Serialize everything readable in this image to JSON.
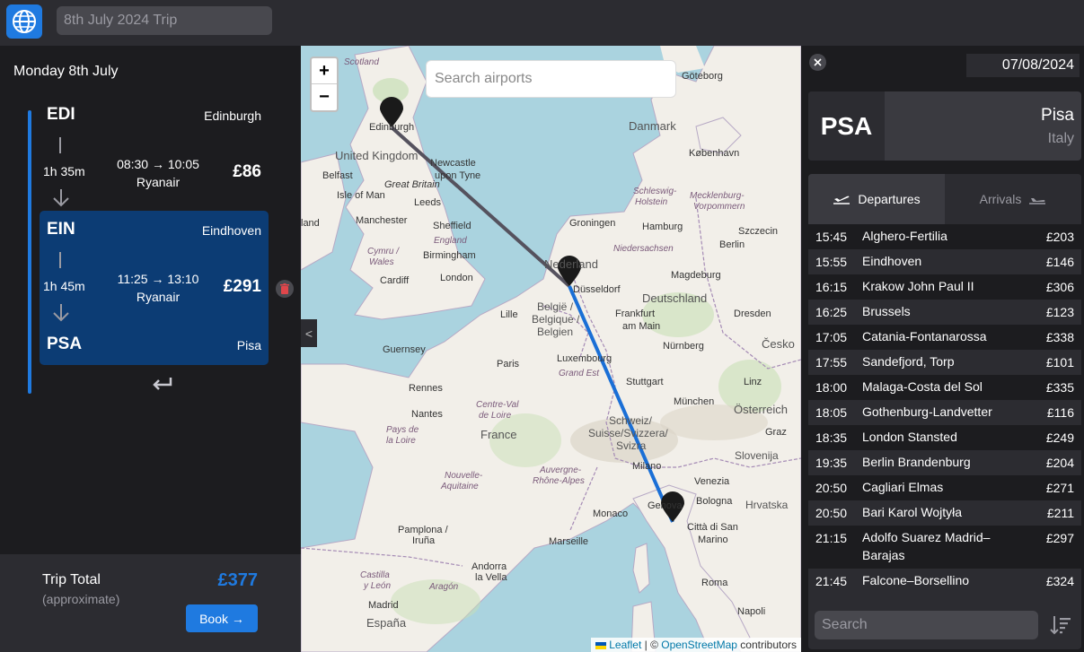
{
  "app": {
    "trip_name_placeholder": "8th July 2024 Trip"
  },
  "itinerary": {
    "day_title": "Monday 8th July",
    "legs": [
      {
        "from_code": "EDI",
        "from_city": "Edinburgh",
        "duration": "1h 35m",
        "times": "08:30 → 10:05",
        "airline": "Ryanair",
        "price": "£86"
      },
      {
        "from_code": "EIN",
        "from_city": "Eindhoven",
        "duration": "1h 45m",
        "times": "11:25 → 13:10",
        "airline": "Ryanair",
        "price": "£291"
      }
    ],
    "final_code": "PSA",
    "final_city": "Pisa",
    "total_label": "Trip Total",
    "total_sub": "(approximate)",
    "total_price": "£377",
    "book_label": "Book →"
  },
  "map": {
    "search_placeholder": "Search airports",
    "zoom_in": "+",
    "zoom_out": "−",
    "collapse": "<",
    "attribution_leaflet": "Leaflet",
    "attribution_sep": " | © ",
    "attribution_osm": "OpenStreetMap",
    "attribution_tail": " contributors",
    "labels": {
      "scotland": "Scotland",
      "edinburgh": "Edinburgh",
      "uk": "United Kingdom",
      "newcastle": "Newcastle",
      "upon_tyne": "upon Tyne",
      "belfast": "Belfast",
      "isle_of_man": "Isle of Man",
      "great_britain": "Great Britain",
      "leeds": "Leeds",
      "manchester": "Manchester",
      "sheffield": "Sheffield",
      "england": "England",
      "cymru": "Cymru /",
      "wales": "Wales",
      "birmingham": "Birmingham",
      "cardiff": "Cardiff",
      "london": "London",
      "land": "land",
      "guernsey": "Guernsey",
      "rennes": "Rennes",
      "paris": "Paris",
      "nantes": "Nantes",
      "france": "France",
      "pays": "Pays de",
      "loire": "la Loire",
      "centre": "Centre-Val",
      "de_loire": "de Loire",
      "grand_est": "Grand Est",
      "nouvelle": "Nouvelle-",
      "aquitaine": "Aquitaine",
      "auvergne": "Auvergne-",
      "rhone": "Rhône-Alpes",
      "monaco": "Monaco",
      "marseille": "Marseille",
      "pamplona": "Pamplona /",
      "iruna": "Iruña",
      "castilla": "Castilla",
      "y_leon": "y León",
      "aragon": "Aragón",
      "andorra": "Andorra",
      "la_vella": "la Vella",
      "madrid": "Madrid",
      "espana": "España",
      "goteborg": "Göteborg",
      "danmark": "Danmark",
      "kobenhavn": "København",
      "schleswig": "Schleswig-",
      "holstein": "Holstein",
      "mecklenburg": "Mecklenburg-",
      "vorpommern": "Vorpommern",
      "hamburg": "Hamburg",
      "szczecin": "Szczecin",
      "groningen": "Groningen",
      "niedersachsen": "Niedersachsen",
      "berlin": "Berlin",
      "nederland": "Nederland",
      "magdeburg": "Magdeburg",
      "dusseldorf": "Düsseldorf",
      "deutschland": "Deutschland",
      "lille": "Lille",
      "belgie": "België /",
      "belgique": "Belgique /",
      "belgien": "Belgien",
      "frankfurt": "Frankfurt",
      "am_main": "am Main",
      "dresden": "Dresden",
      "luxembourg": "Luxembourg",
      "nurnberg": "Nürnberg",
      "cesko": "Česko",
      "stuttgart": "Stuttgart",
      "linz": "Linz",
      "munchen": "München",
      "osterreich": "Österreich",
      "schweiz": "Schweiz/",
      "suisse": "Suisse/Svizzera/",
      "svizra": "Svizra",
      "graz": "Graz",
      "slovenija": "Slovenija",
      "milano": "Milano",
      "venezia": "Venezia",
      "hrvatska": "Hrvatska",
      "bologna": "Bologna",
      "genova": "Genova",
      "citta": "Città di San",
      "marino": "Marino",
      "roma": "Roma",
      "napoli": "Napoli"
    }
  },
  "airport": {
    "date": "07/08/2024",
    "code": "PSA",
    "city": "Pisa",
    "country": "Italy",
    "tab_departures": "Departures",
    "tab_arrivals": "Arrivals",
    "search_placeholder": "Search",
    "flights": [
      {
        "time": "15:45",
        "dest": "Alghero-Fertilia",
        "price": "£203"
      },
      {
        "time": "15:55",
        "dest": "Eindhoven",
        "price": "£146"
      },
      {
        "time": "16:15",
        "dest": "Krakow John Paul II",
        "price": "£306"
      },
      {
        "time": "16:25",
        "dest": "Brussels",
        "price": "£123"
      },
      {
        "time": "17:05",
        "dest": "Catania-Fontanarossa",
        "price": "£338"
      },
      {
        "time": "17:55",
        "dest": "Sandefjord, Torp",
        "price": "£101"
      },
      {
        "time": "18:00",
        "dest": "Malaga-Costa del Sol",
        "price": "£335"
      },
      {
        "time": "18:05",
        "dest": "Gothenburg-Landvetter",
        "price": "£116"
      },
      {
        "time": "18:35",
        "dest": "London Stansted",
        "price": "£249"
      },
      {
        "time": "19:35",
        "dest": "Berlin Brandenburg",
        "price": "£204"
      },
      {
        "time": "20:50",
        "dest": "Cagliari Elmas",
        "price": "£271"
      },
      {
        "time": "20:50",
        "dest": "Bari Karol Wojtyła",
        "price": "£211"
      },
      {
        "time": "21:15",
        "dest": "Adolfo Suarez Madrid–Barajas",
        "price": "£297"
      },
      {
        "time": "21:45",
        "dest": "Falcone–Borsellino",
        "price": "£324"
      }
    ]
  },
  "colors": {
    "accent": "#1f7ae0",
    "selected_leg": "#0c3c74",
    "route_past": "#55525e",
    "route_active": "#1a6fd6"
  }
}
